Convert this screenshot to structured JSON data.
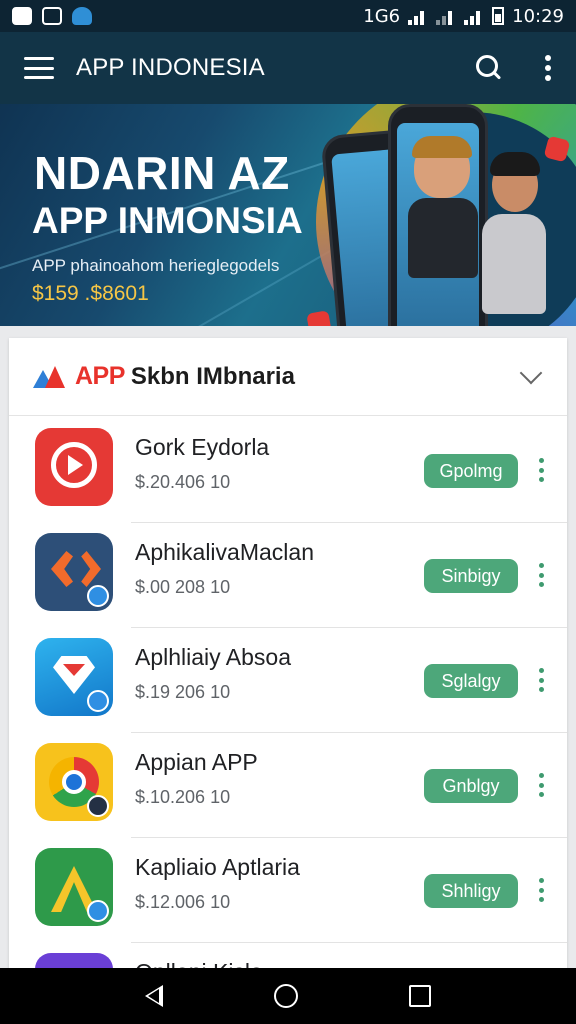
{
  "status_bar": {
    "time": "10:29",
    "network": "1G6",
    "icons": [
      "notification-icon",
      "screenshot-icon",
      "app-icon",
      "wifi-icon",
      "signal-icon",
      "signal-icon",
      "battery-icon"
    ]
  },
  "app_bar": {
    "title": "APP INDONESIA",
    "icons": [
      "menu-icon",
      "search-icon",
      "more-vert-icon"
    ]
  },
  "banner": {
    "headline": "NDARIN AZ",
    "headline2": "APP INMONSIA",
    "subtitle": "APP phainoahom herieglegodels",
    "price": "$159 .$8601"
  },
  "section": {
    "logo_text": "APP",
    "title": "Skbn IMbnaria",
    "expand_icon": "chevron-down-icon"
  },
  "apps": [
    {
      "name": "Gork Eydorla",
      "price": "$.20.406 10",
      "action": "Gpolmg",
      "icon": "play-icon"
    },
    {
      "name": "AphikalivaMaclan",
      "price": "$.00 208 10",
      "action": "Sinbigy",
      "icon": "code-icon"
    },
    {
      "name": "Aplhliaiy Absoa",
      "price": "$.19 206 10",
      "action": "Sglalgy",
      "icon": "diamond-icon"
    },
    {
      "name": "Appian APP",
      "price": "$.10.206 10",
      "action": "Gnblgy",
      "icon": "chrome-icon"
    },
    {
      "name": "Kapliaio Aptlaria",
      "price": "$.12.006 10",
      "action": "Shhligy",
      "icon": "studio-icon"
    },
    {
      "name": "Opllani Kislo",
      "price": "",
      "action": "",
      "icon": "app-icon"
    }
  ],
  "nav_bar": {
    "icons": [
      "back-icon",
      "home-icon",
      "recents-icon"
    ]
  },
  "colors": {
    "header_bg": "#123447",
    "accent_green": "#4da77a",
    "brand_red": "#e8322b",
    "price_yellow": "#f6c646"
  }
}
